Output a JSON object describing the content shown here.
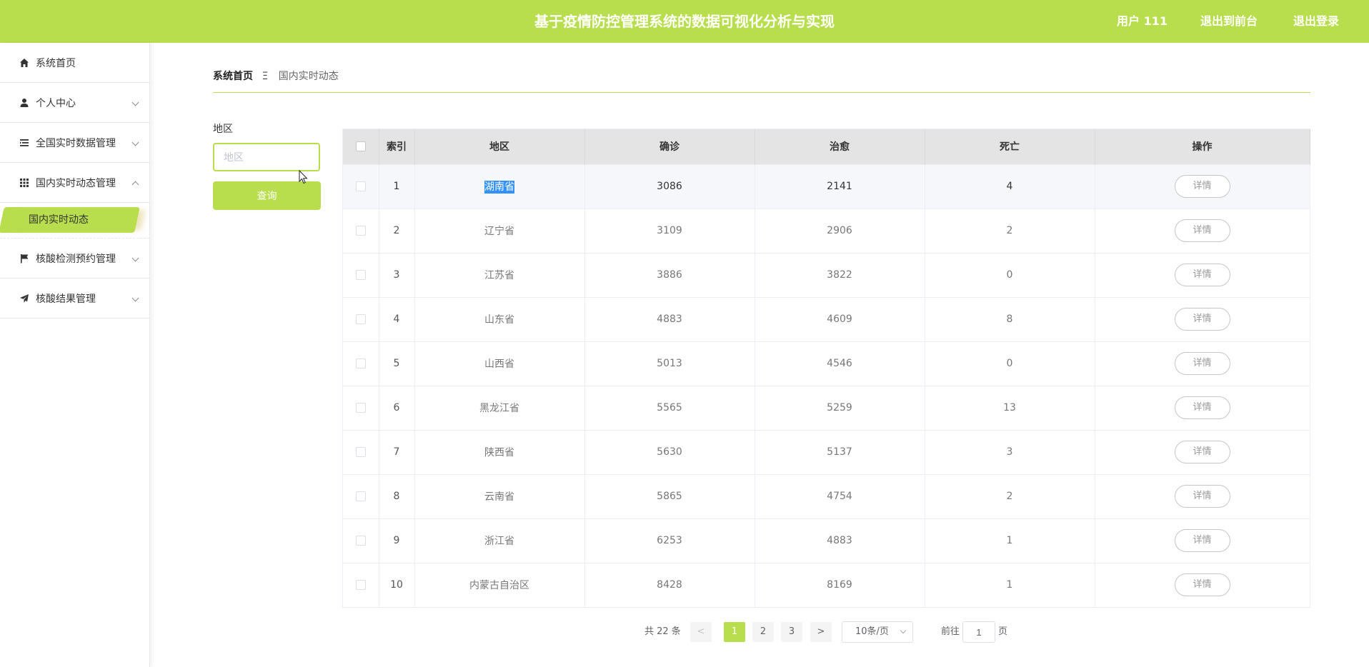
{
  "header": {
    "title": "基于疫情防控管理系统的数据可视化分析与实现",
    "user_label": "用户 111",
    "back_front": "退出到前台",
    "logout": "退出登录"
  },
  "sidebar": {
    "items": [
      {
        "label": "系统首页",
        "icon": "home-icon"
      },
      {
        "label": "个人中心",
        "icon": "user-icon"
      },
      {
        "label": "全国实时数据管理",
        "icon": "list-icon"
      },
      {
        "label": "国内实时动态管理",
        "icon": "grid-icon"
      },
      {
        "label": "核酸检测预约管理",
        "icon": "flag-icon"
      },
      {
        "label": "核酸结果管理",
        "icon": "send-icon"
      }
    ],
    "active_sub": "国内实时动态"
  },
  "breadcrumb": {
    "home": "系统首页",
    "separator": "Ξ",
    "current": "国内实时动态"
  },
  "search": {
    "label": "地区",
    "placeholder": "地区",
    "value": "",
    "button": "查询"
  },
  "table": {
    "headers": [
      "索引",
      "地区",
      "确诊",
      "治愈",
      "死亡",
      "操作"
    ],
    "detail_label": "详情",
    "rows": [
      {
        "idx": "1",
        "region": "湖南省",
        "confirmed": "3086",
        "cured": "2141",
        "dead": "4"
      },
      {
        "idx": "2",
        "region": "辽宁省",
        "confirmed": "3109",
        "cured": "2906",
        "dead": "2"
      },
      {
        "idx": "3",
        "region": "江苏省",
        "confirmed": "3886",
        "cured": "3822",
        "dead": "0"
      },
      {
        "idx": "4",
        "region": "山东省",
        "confirmed": "4883",
        "cured": "4609",
        "dead": "8"
      },
      {
        "idx": "5",
        "region": "山西省",
        "confirmed": "5013",
        "cured": "4546",
        "dead": "0"
      },
      {
        "idx": "6",
        "region": "黑龙江省",
        "confirmed": "5565",
        "cured": "5259",
        "dead": "13"
      },
      {
        "idx": "7",
        "region": "陕西省",
        "confirmed": "5630",
        "cured": "5137",
        "dead": "3"
      },
      {
        "idx": "8",
        "region": "云南省",
        "confirmed": "5865",
        "cured": "4754",
        "dead": "2"
      },
      {
        "idx": "9",
        "region": "浙江省",
        "confirmed": "6253",
        "cured": "4883",
        "dead": "1"
      },
      {
        "idx": "10",
        "region": "内蒙古自治区",
        "confirmed": "8428",
        "cured": "8169",
        "dead": "1"
      }
    ]
  },
  "pagination": {
    "total": "共 22 条",
    "prev": "<",
    "pages": [
      "1",
      "2",
      "3"
    ],
    "current": "1",
    "next": ">",
    "page_size": "10条/页",
    "goto_prefix": "前往",
    "goto_value": "1",
    "goto_suffix": "页"
  },
  "colors": {
    "accent": "#b9de4d",
    "selection": "#3390ff"
  }
}
